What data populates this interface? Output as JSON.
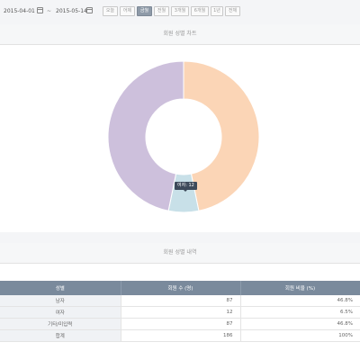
{
  "toolbar": {
    "start_date": "2015-04-01",
    "end_date": "2015-05-14",
    "separator": "~",
    "periods": [
      "오늘",
      "어제",
      "금월",
      "전월",
      "3개월",
      "6개월",
      "1년",
      "전체"
    ],
    "active_period": "금월"
  },
  "chart_panel": {
    "title": "회원 성별 차트"
  },
  "chart_data": {
    "type": "pie",
    "categories": [
      "남자",
      "여자",
      "기타/미입력"
    ],
    "values": [
      87,
      12,
      87
    ],
    "colors": [
      "#fbd5b6",
      "#c8e0e8",
      "#cdc0dc"
    ],
    "tooltip": "여자: 12"
  },
  "table_panel": {
    "title": "회원 성별 내역"
  },
  "table": {
    "headers": [
      "성별",
      "회원 수 (명)",
      "회원 비율 (%)"
    ],
    "rows": [
      [
        "남자",
        "87",
        "46.8%"
      ],
      [
        "여자",
        "12",
        "6.5%"
      ],
      [
        "기타/미입력",
        "87",
        "46.8%"
      ],
      [
        "합계",
        "186",
        "100%"
      ]
    ]
  }
}
